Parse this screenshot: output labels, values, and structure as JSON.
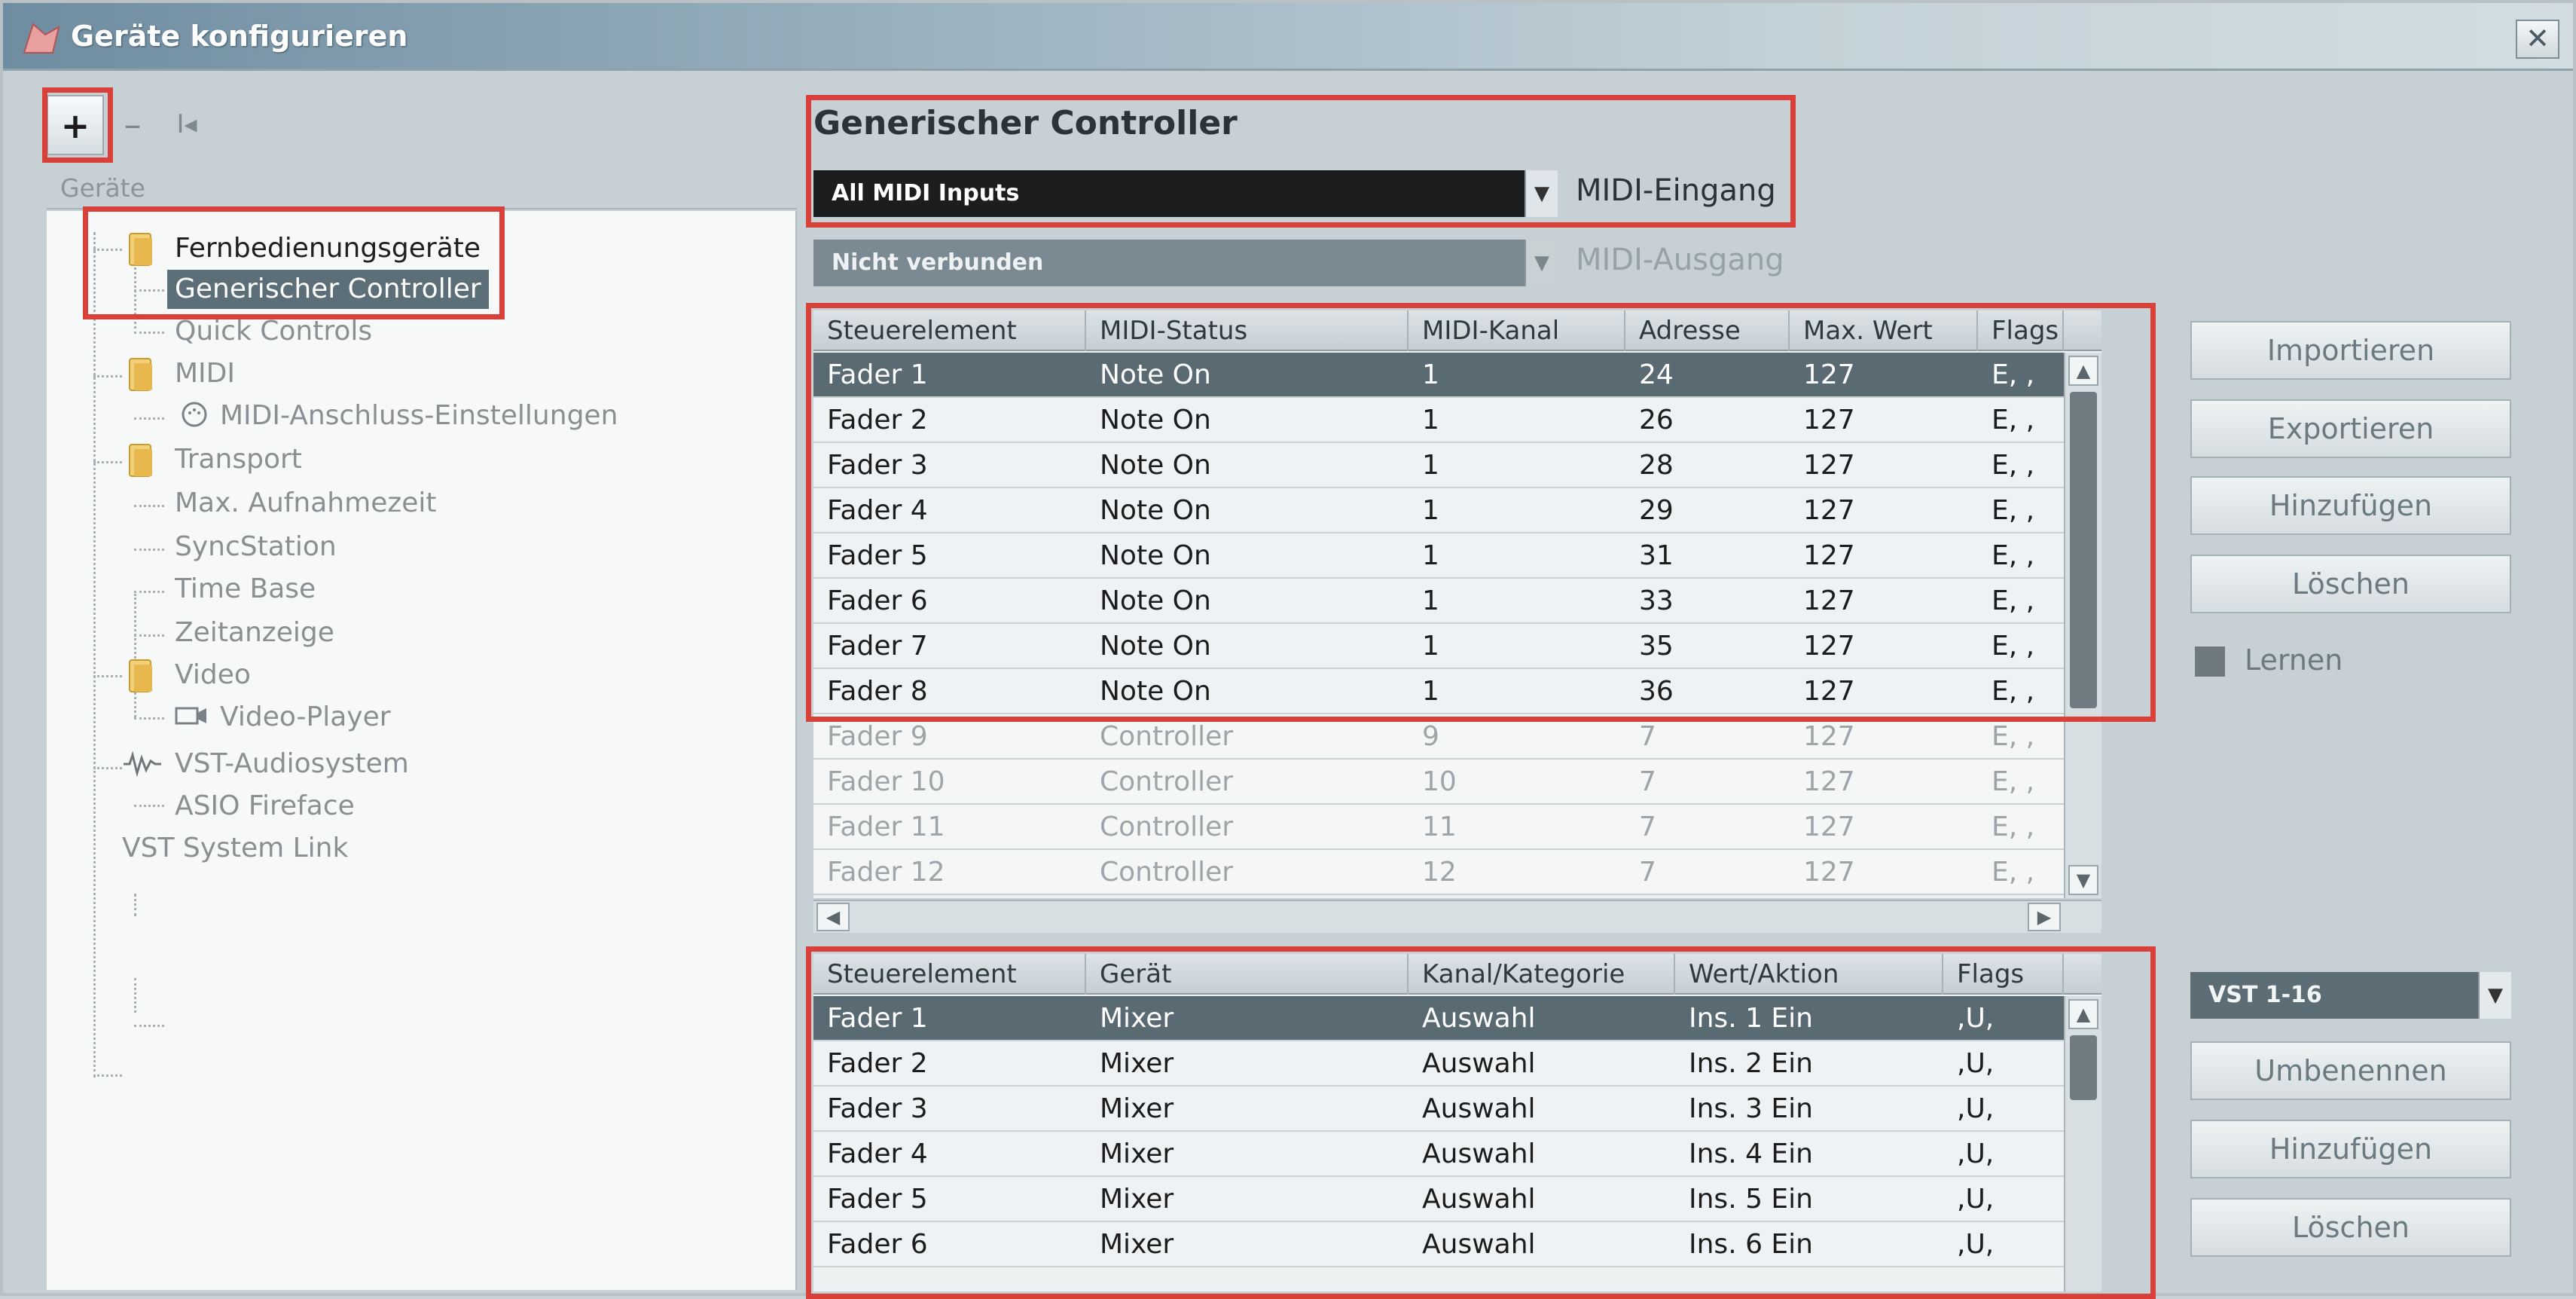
{
  "window": {
    "title": "Geräte konfigurieren",
    "close_symbol": "✕"
  },
  "toolbar": {
    "add_symbol": "+",
    "remove_symbol": "–",
    "reset_symbol": "I◂"
  },
  "tree": {
    "header": "Geräte",
    "items": [
      {
        "label": "Fernbedienungsgeräte",
        "icon": "folder-icon"
      },
      {
        "label": "Generischer Controller"
      },
      {
        "label": "Quick Controls"
      },
      {
        "label": "MIDI",
        "icon": "folder-icon"
      },
      {
        "label": "MIDI-Anschluss-Einstellungen",
        "icon": "midi-port-icon"
      },
      {
        "label": "Transport",
        "icon": "folder-icon"
      },
      {
        "label": "Max. Aufnahmezeit"
      },
      {
        "label": "SyncStation"
      },
      {
        "label": "Time Base"
      },
      {
        "label": "Zeitanzeige"
      },
      {
        "label": "Video",
        "icon": "folder-icon"
      },
      {
        "label": "Video-Player",
        "icon": "video-icon"
      },
      {
        "label": "VST-Audiosystem",
        "icon": "audio-system-icon"
      },
      {
        "label": "ASIO Fireface"
      },
      {
        "label": "VST System Link"
      }
    ]
  },
  "controller": {
    "title": "Generischer Controller",
    "midi_input_value": "All MIDI Inputs",
    "midi_input_label": "MIDI-Eingang",
    "midi_output_value": "Nicht verbunden",
    "midi_output_label": "MIDI-Ausgang"
  },
  "table1": {
    "headers": [
      "Steuerelement",
      "MIDI-Status",
      "MIDI-Kanal",
      "Adresse",
      "Max. Wert",
      "Flags"
    ],
    "rows": [
      [
        "Fader 1",
        "Note On",
        "1",
        "24",
        "127",
        "E, ,"
      ],
      [
        "Fader 2",
        "Note On",
        "1",
        "26",
        "127",
        "E, ,"
      ],
      [
        "Fader 3",
        "Note On",
        "1",
        "28",
        "127",
        "E, ,"
      ],
      [
        "Fader 4",
        "Note On",
        "1",
        "29",
        "127",
        "E, ,"
      ],
      [
        "Fader 5",
        "Note On",
        "1",
        "31",
        "127",
        "E, ,"
      ],
      [
        "Fader 6",
        "Note On",
        "1",
        "33",
        "127",
        "E, ,"
      ],
      [
        "Fader 7",
        "Note On",
        "1",
        "35",
        "127",
        "E, ,"
      ],
      [
        "Fader 8",
        "Note On",
        "1",
        "36",
        "127",
        "E, ,"
      ],
      [
        "Fader 9",
        "Controller",
        "9",
        "7",
        "127",
        "E, ,"
      ],
      [
        "Fader 10",
        "Controller",
        "10",
        "7",
        "127",
        "E, ,"
      ],
      [
        "Fader 11",
        "Controller",
        "11",
        "7",
        "127",
        "E, ,"
      ],
      [
        "Fader 12",
        "Controller",
        "12",
        "7",
        "127",
        "E, ,"
      ]
    ]
  },
  "table2": {
    "headers": [
      "Steuerelement",
      "Gerät",
      "Kanal/Kategorie",
      "Wert/Aktion",
      "Flags"
    ],
    "rows": [
      [
        "Fader 1",
        "Mixer",
        "Auswahl",
        "Ins. 1 Ein",
        ",U,"
      ],
      [
        "Fader 2",
        "Mixer",
        "Auswahl",
        "Ins. 2 Ein",
        ",U,"
      ],
      [
        "Fader 3",
        "Mixer",
        "Auswahl",
        "Ins. 3 Ein",
        ",U,"
      ],
      [
        "Fader 4",
        "Mixer",
        "Auswahl",
        "Ins. 4 Ein",
        ",U,"
      ],
      [
        "Fader 5",
        "Mixer",
        "Auswahl",
        "Ins. 5 Ein",
        ",U,"
      ],
      [
        "Fader 6",
        "Mixer",
        "Auswahl",
        "Ins. 6 Ein",
        ",U,"
      ]
    ]
  },
  "buttons": {
    "import": "Importieren",
    "export": "Exportieren",
    "add": "Hinzufügen",
    "delete": "Löschen",
    "learn": "Lernen",
    "bank_select": "VST 1-16",
    "rename": "Umbenennen",
    "add2": "Hinzufügen",
    "delete2": "Löschen"
  },
  "colors": {
    "highlight": "#d9403a",
    "selected_row": "#5a6a73",
    "tree_selected": "#5c6e78"
  }
}
